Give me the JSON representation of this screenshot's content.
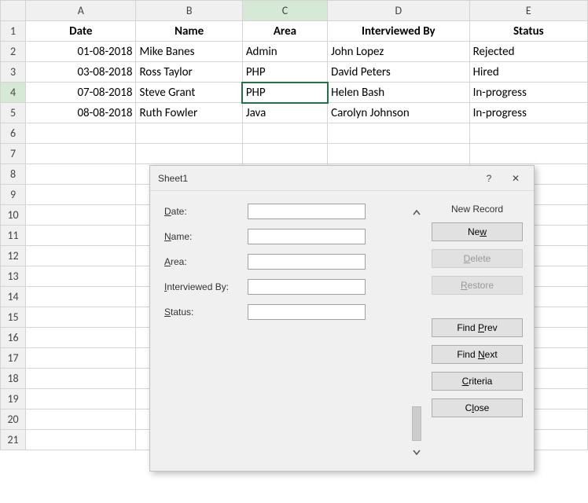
{
  "columns": [
    "A",
    "B",
    "C",
    "D",
    "E"
  ],
  "headers": {
    "date": "Date",
    "name": "Name",
    "area": "Area",
    "interviewed_by": "Interviewed By",
    "status": "Status"
  },
  "rows": [
    {
      "date": "01-08-2018",
      "name": "Mike Banes",
      "area": "Admin",
      "interviewed_by": "John Lopez",
      "status": "Rejected"
    },
    {
      "date": "03-08-2018",
      "name": "Ross Taylor",
      "area": "PHP",
      "interviewed_by": "David Peters",
      "status": "Hired"
    },
    {
      "date": "07-08-2018",
      "name": "Steve Grant",
      "area": "PHP",
      "interviewed_by": "Helen Bash",
      "status": "In-progress"
    },
    {
      "date": "08-08-2018",
      "name": "Ruth Fowler",
      "area": "Java",
      "interviewed_by": "Carolyn Johnson",
      "status": "In-progress"
    }
  ],
  "active_cell": {
    "row": 4,
    "col": "C"
  },
  "total_visible_rows": 21,
  "dialog": {
    "title": "Sheet1",
    "record_label": "New Record",
    "fields": {
      "date": {
        "label": "Date:",
        "underline": "D",
        "value": ""
      },
      "name": {
        "label": "Name:",
        "underline": "N",
        "value": ""
      },
      "area": {
        "label": "Area:",
        "underline": "A",
        "value": ""
      },
      "interviewed_by": {
        "label": "Interviewed By:",
        "underline": "I",
        "value": ""
      },
      "status": {
        "label": "Status:",
        "underline": "S",
        "value": ""
      }
    },
    "buttons": {
      "new": "New",
      "delete": "Delete",
      "restore": "Restore",
      "find_prev": "Find Prev",
      "find_next": "Find Next",
      "criteria": "Criteria",
      "close": "Close"
    },
    "help": "?",
    "close_icon": "✕"
  },
  "chart_data": {
    "type": "table",
    "headers": [
      "Date",
      "Name",
      "Area",
      "Interviewed By",
      "Status"
    ],
    "rows": [
      [
        "01-08-2018",
        "Mike Banes",
        "Admin",
        "John Lopez",
        "Rejected"
      ],
      [
        "03-08-2018",
        "Ross Taylor",
        "PHP",
        "David Peters",
        "Hired"
      ],
      [
        "07-08-2018",
        "Steve Grant",
        "PHP",
        "Helen Bash",
        "In-progress"
      ],
      [
        "08-08-2018",
        "Ruth Fowler",
        "Java",
        "Carolyn Johnson",
        "In-progress"
      ]
    ]
  }
}
